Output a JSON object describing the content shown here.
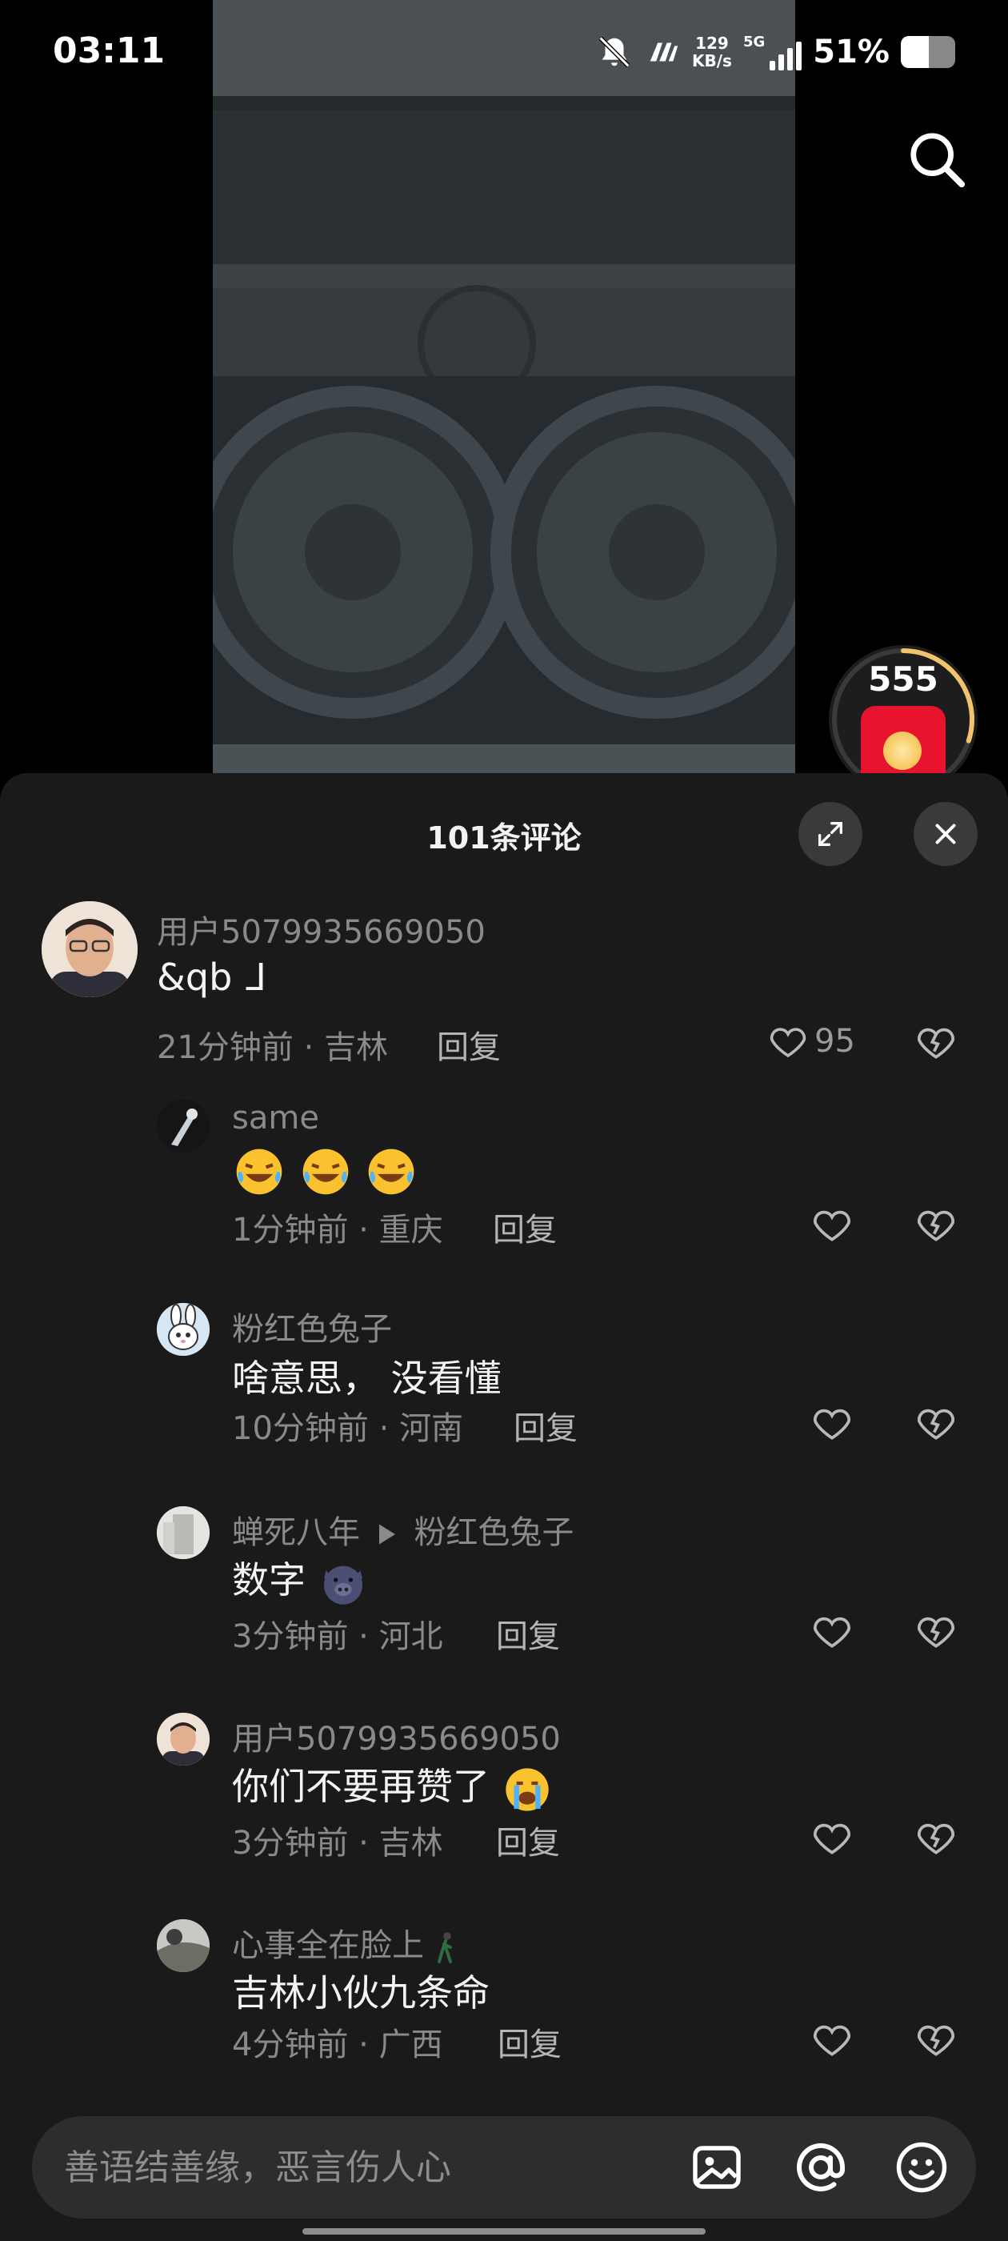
{
  "status_bar": {
    "time": "03:11",
    "net_speed_value": "129",
    "net_speed_unit": "KB/s",
    "network_type": "5G",
    "battery_percent": "51%",
    "battery_level": 0.51
  },
  "video": {
    "search_icon": "search-icon",
    "red_packet_count": "555",
    "red_packet_progress": 0.3
  },
  "sheet": {
    "title": "101条评论",
    "expand_icon": "expand-icon",
    "close_icon": "close-icon"
  },
  "comments": [
    {
      "user": "用户5079935669050",
      "text": "&qb ᒧ",
      "time": "21分钟前",
      "location": "吉林",
      "reply": "回复",
      "likes": "95"
    },
    {
      "user": "same",
      "text": "",
      "emojis": [
        "laugh-cry",
        "laugh-cry",
        "laugh-cry"
      ],
      "time": "1分钟前",
      "location": "重庆",
      "reply": "回复"
    },
    {
      "user": "粉红色兔子",
      "text": "啥意思， 没看懂",
      "time": "10分钟前",
      "location": "河南",
      "reply": "回复"
    },
    {
      "user": "蝉死八年",
      "reply_to": "粉红色兔子",
      "text": "数字",
      "emojis": [
        "pig"
      ],
      "time": "3分钟前",
      "location": "河北",
      "reply": "回复"
    },
    {
      "user": "用户5079935669050",
      "text": "你们不要再赞了",
      "emojis": [
        "crying"
      ],
      "time": "3分钟前",
      "location": "吉林",
      "reply": "回复"
    },
    {
      "user": "心事全在脸上",
      "user_icon": "walking-person",
      "text": "吉林小伙九条命",
      "time": "4分钟前",
      "location": "广西",
      "reply": "回复"
    }
  ],
  "input_bar": {
    "placeholder": "善语结善缘，恶言伤人心",
    "image_icon": "image-icon",
    "mention_icon": "at-icon",
    "emoji_icon": "emoji-icon"
  },
  "colors": {
    "sheet_bg": "#1a1a1a",
    "red_packet": "#e8132f",
    "ring": "#f2c36b"
  }
}
